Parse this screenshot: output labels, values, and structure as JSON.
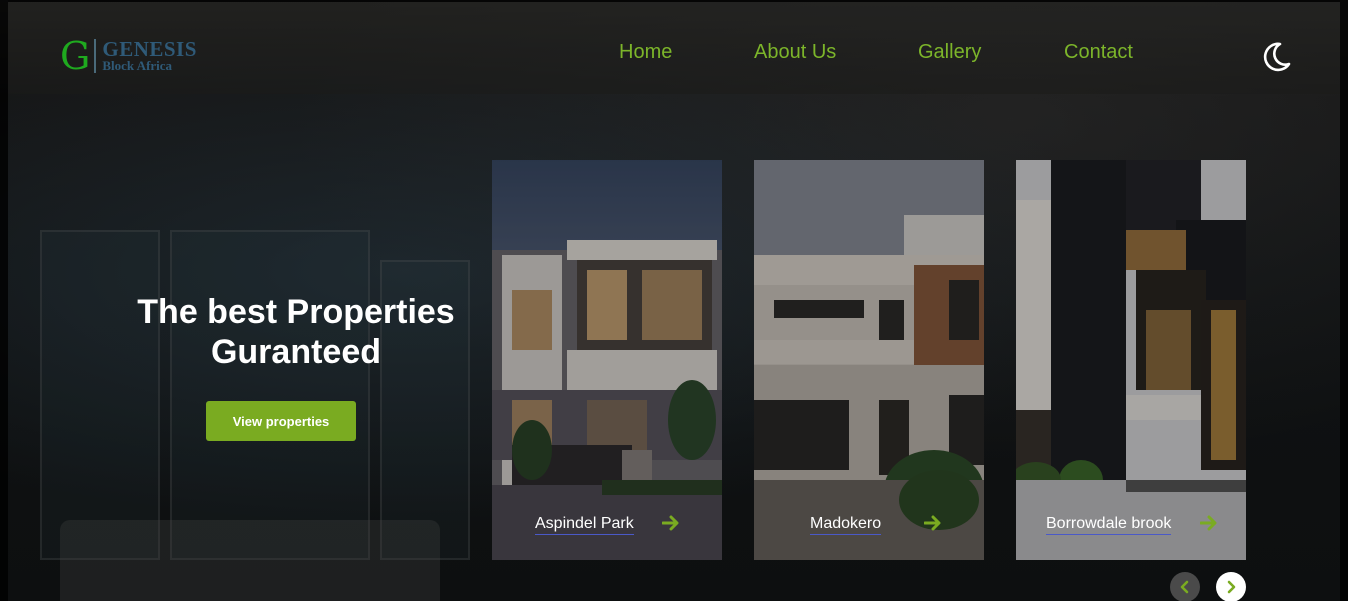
{
  "brand": {
    "logo_letter": "G",
    "name": "GENESIS",
    "tagline": "Block Africa",
    "color": "#1faa1f"
  },
  "nav": {
    "items": [
      {
        "label": "Home"
      },
      {
        "label": "About Us"
      },
      {
        "label": "Gallery"
      },
      {
        "label": "Contact"
      }
    ],
    "link_color": "#7cb52a",
    "theme_toggle_icon": "moon-icon"
  },
  "hero": {
    "title_line1": "The best Properties",
    "title_line2": "Guranteed",
    "cta_label": "View properties",
    "accent": "#7aab21"
  },
  "properties": [
    {
      "name": "Aspindel Park",
      "icon": "arrow-right-icon"
    },
    {
      "name": "Madokero",
      "icon": "arrow-right-icon"
    },
    {
      "name": "Borrowdale brook",
      "icon": "arrow-right-icon"
    }
  ],
  "carousel": {
    "prev_icon": "chevron-left-icon",
    "next_icon": "chevron-right-icon"
  }
}
